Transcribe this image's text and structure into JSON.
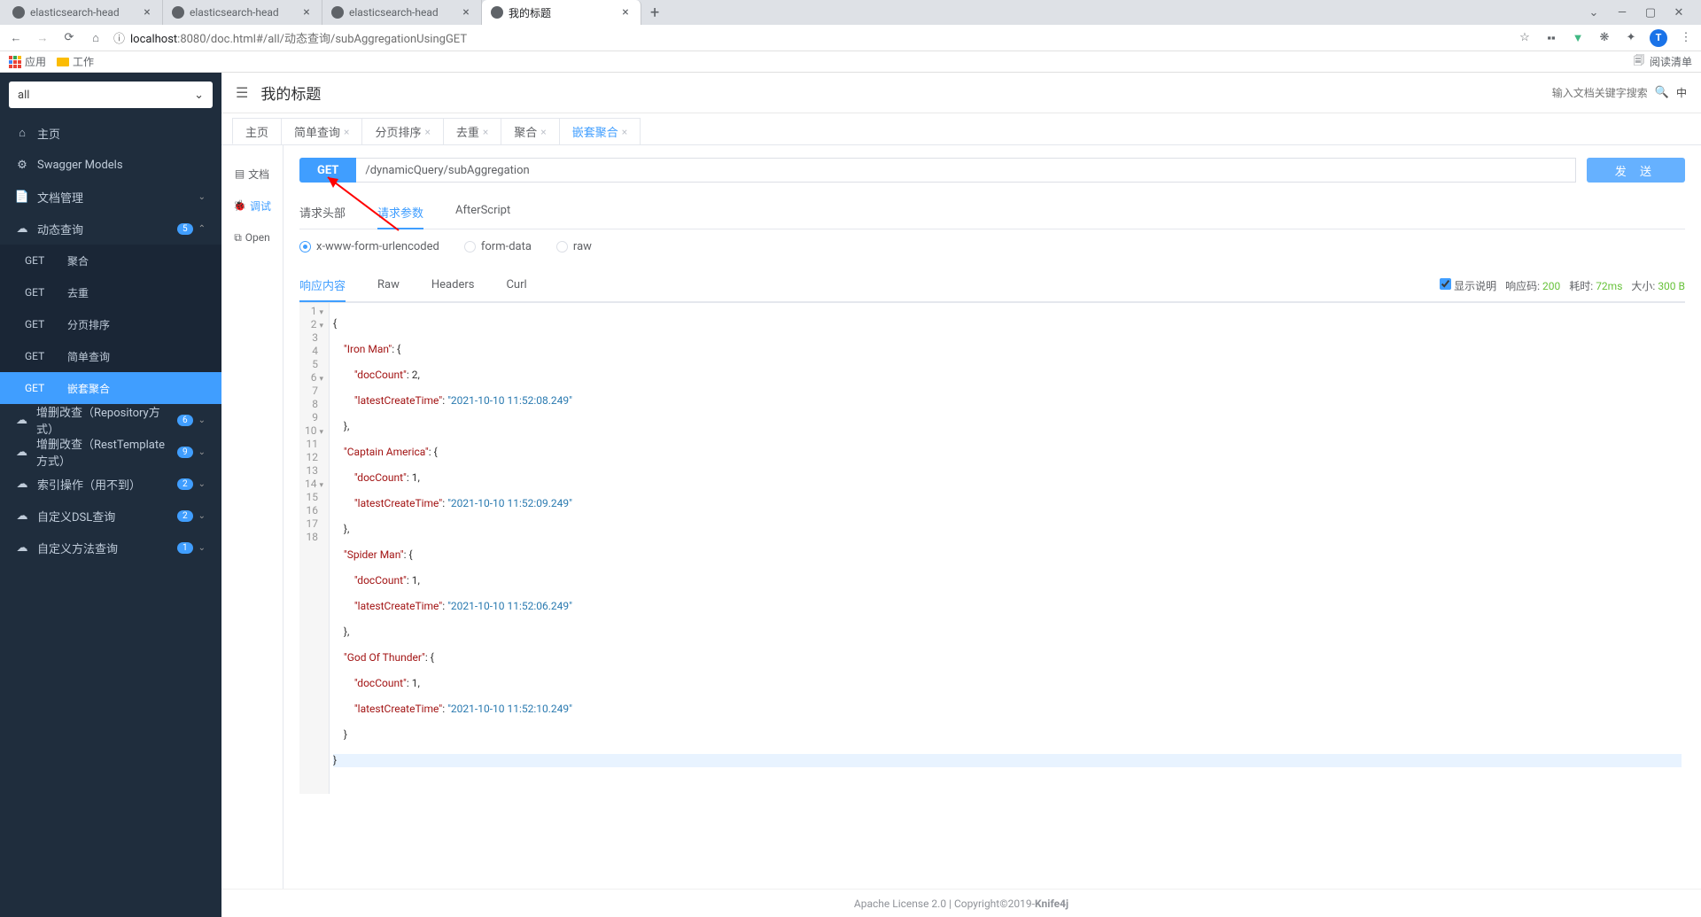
{
  "browser": {
    "tabs": [
      {
        "title": "elasticsearch-head",
        "active": false
      },
      {
        "title": "elasticsearch-head",
        "active": false
      },
      {
        "title": "elasticsearch-head",
        "active": false
      },
      {
        "title": "我的标题",
        "active": true
      }
    ],
    "url_host": "localhost",
    "url_path": ":8080/doc.html#/all/动态查询/subAggregationUsingGET",
    "avatar_letter": "T",
    "bookmarks": {
      "apps": "应用",
      "work": "工作",
      "reading_list": "阅读清单"
    }
  },
  "sidebar": {
    "select_value": "all",
    "home": "主页",
    "swagger": "Swagger Models",
    "doc_mgmt": "文档管理",
    "dynamic_query": {
      "label": "动态查询",
      "badge": "5"
    },
    "sub_items": [
      {
        "method": "GET",
        "label": "聚合"
      },
      {
        "method": "GET",
        "label": "去重"
      },
      {
        "method": "GET",
        "label": "分页排序"
      },
      {
        "method": "GET",
        "label": "简单查询"
      },
      {
        "method": "GET",
        "label": "嵌套聚合",
        "active": true
      }
    ],
    "others": [
      {
        "label": "增删改查（Repository方式）",
        "badge": "6"
      },
      {
        "label": "增删改查（RestTemplate方式）",
        "badge": "9"
      },
      {
        "label": "索引操作（用不到）",
        "badge": "2"
      },
      {
        "label": "自定义DSL查询",
        "badge": "2"
      },
      {
        "label": "自定义方法查询",
        "badge": "1"
      }
    ]
  },
  "header": {
    "title": "我的标题",
    "search_placeholder": "输入文档关键字搜索",
    "lang": "中"
  },
  "tabs": [
    {
      "label": "主页",
      "closable": false
    },
    {
      "label": "简单查询",
      "closable": true
    },
    {
      "label": "分页排序",
      "closable": true
    },
    {
      "label": "去重",
      "closable": true
    },
    {
      "label": "聚合",
      "closable": true
    },
    {
      "label": "嵌套聚合",
      "closable": true,
      "active": true
    }
  ],
  "side_tabs": {
    "doc": "文档",
    "debug": "调试",
    "open": "Open"
  },
  "request": {
    "method": "GET",
    "url": "/dynamicQuery/subAggregation",
    "send": "发 送",
    "tabs": {
      "headers": "请求头部",
      "params": "请求参数",
      "after": "AfterScript"
    },
    "body_types": {
      "form_url": "x-www-form-urlencoded",
      "form_data": "form-data",
      "raw": "raw"
    }
  },
  "response": {
    "tabs": {
      "content": "响应内容",
      "raw": "Raw",
      "headers": "Headers",
      "curl": "Curl"
    },
    "show_desc": "显示说明",
    "code_label": "响应码:",
    "code": "200",
    "time_label": "耗时:",
    "time": "72ms",
    "size_label": "大小:",
    "size": "300 B"
  },
  "code": {
    "l1": "{",
    "l2p": "    ",
    "l2k": "\"Iron Man\"",
    "l2s": ": {",
    "l3p": "        ",
    "l3k": "\"docCount\"",
    "l3s": ": ",
    "l3v": "2",
    "l3e": ",",
    "l4p": "        ",
    "l4k": "\"latestCreateTime\"",
    "l4s": ": ",
    "l4v": "\"2021-10-10 11:52:08.249\"",
    "l5": "    },",
    "l6p": "    ",
    "l6k": "\"Captain America\"",
    "l6s": ": {",
    "l7p": "        ",
    "l7k": "\"docCount\"",
    "l7s": ": ",
    "l7v": "1",
    "l7e": ",",
    "l8p": "        ",
    "l8k": "\"latestCreateTime\"",
    "l8s": ": ",
    "l8v": "\"2021-10-10 11:52:09.249\"",
    "l9": "    },",
    "l10p": "    ",
    "l10k": "\"Spider Man\"",
    "l10s": ": {",
    "l11p": "        ",
    "l11k": "\"docCount\"",
    "l11s": ": ",
    "l11v": "1",
    "l11e": ",",
    "l12p": "        ",
    "l12k": "\"latestCreateTime\"",
    "l12s": ": ",
    "l12v": "\"2021-10-10 11:52:06.249\"",
    "l13": "    },",
    "l14p": "    ",
    "l14k": "\"God Of Thunder\"",
    "l14s": ": {",
    "l15p": "        ",
    "l15k": "\"docCount\"",
    "l15s": ": ",
    "l15v": "1",
    "l15e": ",",
    "l16p": "        ",
    "l16k": "\"latestCreateTime\"",
    "l16s": ": ",
    "l16v": "\"2021-10-10 11:52:10.249\"",
    "l17": "    }",
    "l18": "}"
  },
  "footer": {
    "license": "Apache License 2.0 | Copyright ",
    "year": " 2019-",
    "product": "Knife4j"
  }
}
